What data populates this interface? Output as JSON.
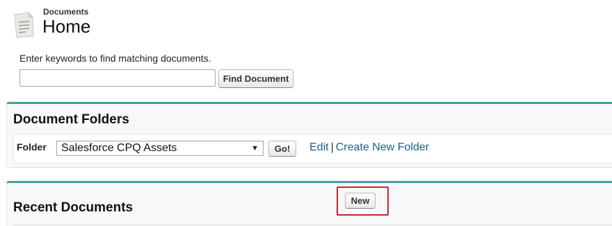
{
  "header": {
    "breadcrumb": "Documents",
    "title": "Home",
    "icon": "document-icon"
  },
  "search": {
    "label": "Enter keywords to find matching documents.",
    "value": "",
    "placeholder": "",
    "button_label": "Find Document"
  },
  "folders_panel": {
    "title": "Document Folders",
    "folder_label": "Folder",
    "selected_folder": "Salesforce CPQ Assets",
    "go_label": "Go!",
    "edit_link": "Edit",
    "separator": "|",
    "create_link": "Create New Folder"
  },
  "recent_panel": {
    "title": "Recent Documents",
    "new_label": "New"
  },
  "colors": {
    "panel_accent": "#4a9aa5",
    "link": "#1d5f8f",
    "highlight": "#c0262c"
  }
}
